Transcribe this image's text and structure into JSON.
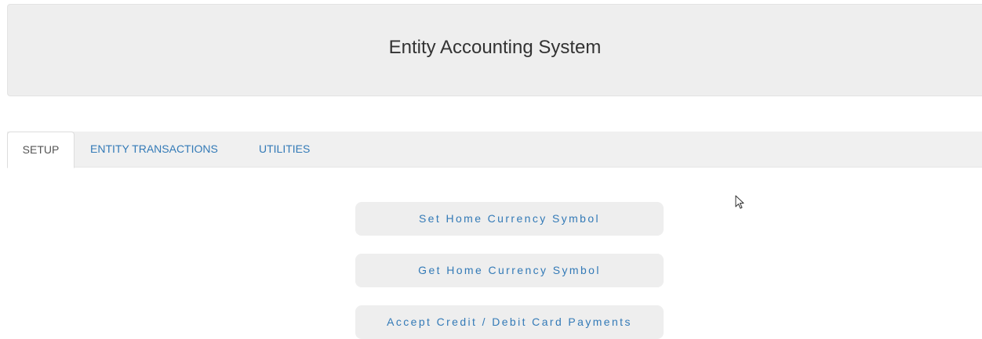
{
  "header": {
    "title": "Entity Accounting System"
  },
  "tabs": [
    {
      "label": "SETUP",
      "active": true
    },
    {
      "label": "ENTITY TRANSACTIONS",
      "active": false
    },
    {
      "label": "UTILITIES",
      "active": false
    }
  ],
  "setup": {
    "buttons": [
      {
        "label": "Set Home Currency Symbol"
      },
      {
        "label": "Get Home Currency Symbol"
      },
      {
        "label": "Accept Credit / Debit Card Payments"
      }
    ]
  },
  "colors": {
    "link": "#337ab7",
    "panel": "#eeeeee",
    "active_tab_text": "#555555"
  },
  "icons": {
    "cursor": "mouse-pointer-icon"
  }
}
